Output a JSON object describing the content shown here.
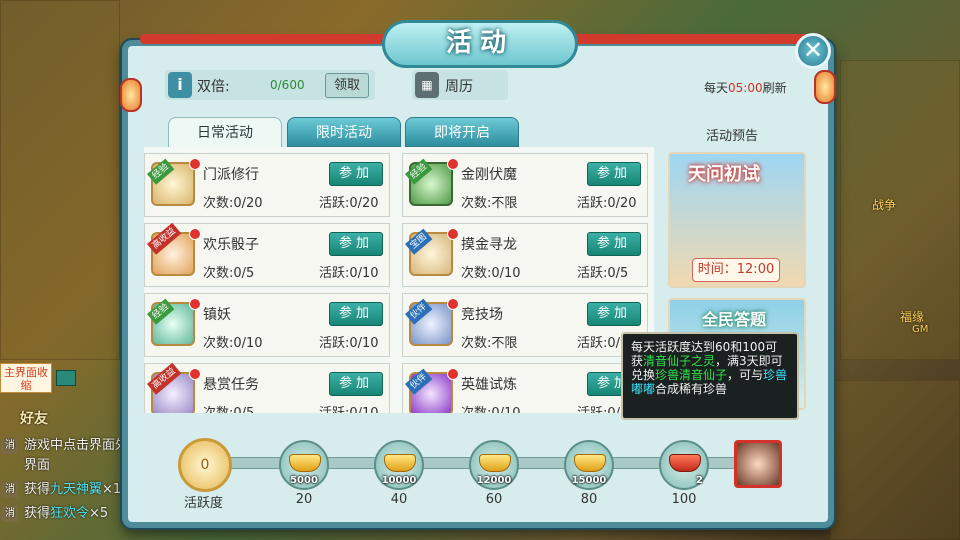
{
  "dialog": {
    "title": "活动",
    "double": {
      "label": "双倍:",
      "value": "0/600",
      "claim_label": "领取"
    },
    "calendar": {
      "label": "周历"
    },
    "refresh": {
      "prefix": "每天",
      "time": "05:00",
      "suffix": "刷新"
    },
    "tabs": [
      {
        "label": "日常活动",
        "active": true
      },
      {
        "label": "限时活动",
        "active": false
      },
      {
        "label": "即将开启",
        "active": false
      }
    ],
    "activities": [
      {
        "name": "门派修行",
        "tag": "经验",
        "count": "次数:0/20",
        "points": "活跃:0/20",
        "join": "参加"
      },
      {
        "name": "金刚伏魔",
        "tag": "经验",
        "count": "次数:不限",
        "points": "活跃:0/20",
        "join": "参加"
      },
      {
        "name": "欢乐骰子",
        "tag": "高收益",
        "count": "次数:0/5",
        "points": "活跃:0/10",
        "join": "参加"
      },
      {
        "name": "摸金寻龙",
        "tag": "宝图",
        "count": "次数:0/10",
        "points": "活跃:0/5",
        "join": "参加"
      },
      {
        "name": "镇妖",
        "tag": "经验",
        "count": "次数:0/10",
        "points": "活跃:0/10",
        "join": "参加"
      },
      {
        "name": "竞技场",
        "tag": "伙伴",
        "count": "次数:不限",
        "points": "活跃:0/5",
        "join": "参加"
      },
      {
        "name": "悬赏任务",
        "tag": "高收益",
        "count": "次数:0/5",
        "points": "活跃:0/10",
        "join": "参加"
      },
      {
        "name": "英雄试炼",
        "tag": "伙伴",
        "count": "次数:0/10",
        "points": "活跃:0/10",
        "join": "参加"
      }
    ],
    "preview": {
      "title": "活动预告",
      "items": [
        {
          "name": "天问初试",
          "time": "时间：12:00"
        },
        {
          "name": "全民答题"
        }
      ]
    },
    "tooltip": {
      "parts": [
        {
          "text": "每天活跃度达到60和100可获",
          "style": "normal"
        },
        {
          "text": "清音仙子之灵",
          "style": "green"
        },
        {
          "text": "，满3天即可兑换",
          "style": "normal"
        },
        {
          "text": "珍兽清音仙子",
          "style": "green"
        },
        {
          "text": "，可与",
          "style": "normal"
        },
        {
          "text": "珍兽嘟嘟",
          "style": "cyan"
        },
        {
          "text": "合成稀有珍兽",
          "style": "normal"
        }
      ]
    },
    "activity_progress": {
      "label": "活跃度",
      "current": "0",
      "rewards": [
        {
          "amount": "5000",
          "points": "20"
        },
        {
          "amount": "10000",
          "points": "40"
        },
        {
          "amount": "12000",
          "points": "60"
        },
        {
          "amount": "15000",
          "points": "80"
        },
        {
          "amount": "2",
          "points": "100"
        }
      ]
    }
  },
  "chat": {
    "collapse_label": "主界面收缩",
    "friend_title": "好友",
    "lines": [
      {
        "tag": "消",
        "text": "游戏中点击界面外"
      },
      {
        "tag": "",
        "text": "界面"
      },
      {
        "tag": "消",
        "text_prefix": "获得",
        "highlight": "九天神翼",
        "suffix": "×1"
      },
      {
        "tag": "消",
        "text_prefix": "获得",
        "highlight": "狂欢令",
        "suffix": "×5"
      }
    ]
  },
  "world": {
    "side_labels": [
      "战争",
      "福缘",
      "GM"
    ]
  }
}
